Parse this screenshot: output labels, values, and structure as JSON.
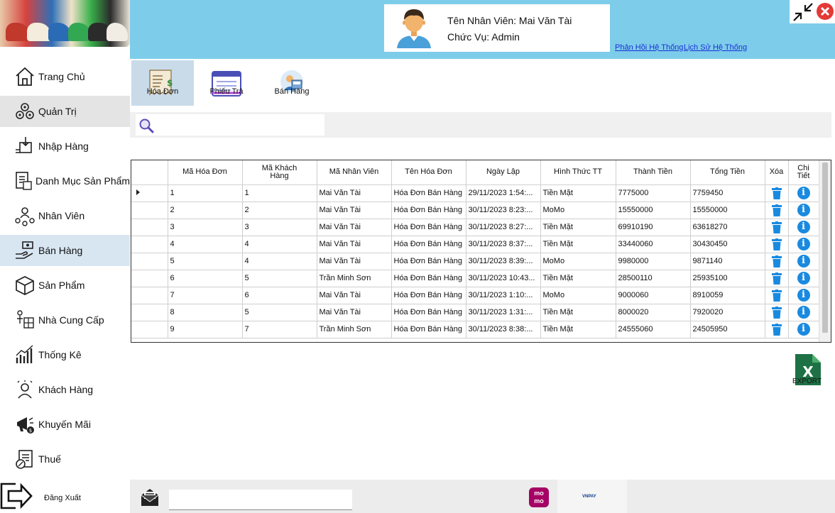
{
  "header": {
    "employee_label": "Tên Nhân Viên: Mai Văn Tài",
    "role_label": "Chức Vụ: Admin",
    "link_feedback": "Phản Hồi Hệ Thống",
    "link_history": "Lịch Sử Hệ Thống"
  },
  "sidebar": {
    "items": [
      {
        "label": "Trang Chủ",
        "icon": "home-icon"
      },
      {
        "label": "Quản Trị",
        "icon": "admin-gears-icon"
      },
      {
        "label": "Nhập Hàng",
        "icon": "import-box-icon"
      },
      {
        "label": "Danh Mục Sản Phẩm",
        "icon": "catalog-icon"
      },
      {
        "label": "Nhân Viên",
        "icon": "employees-icon"
      },
      {
        "label": "Bán Hàng",
        "icon": "sales-icon"
      },
      {
        "label": "Sản Phẩm",
        "icon": "product-box-icon"
      },
      {
        "label": "Nhà Cung Cấp",
        "icon": "supplier-icon"
      },
      {
        "label": "Thống Kê",
        "icon": "statistics-icon"
      },
      {
        "label": "Khách Hàng",
        "icon": "customer-icon"
      },
      {
        "label": "Khuyến Mãi",
        "icon": "promotion-icon"
      },
      {
        "label": "Thuế",
        "icon": "tax-icon"
      }
    ],
    "logout_label": "Đăng Xuất"
  },
  "toolbar": {
    "invoice_label": "Hóa Đơn",
    "return_label": "Phiếu Trả",
    "sales_label": "Bán Hàng"
  },
  "search": {
    "value": ""
  },
  "table": {
    "columns": [
      "Mã Hóa Đơn",
      "Mã Khách Hàng",
      "Mã Nhân Viên",
      "Tên Hóa Đơn",
      "Ngày Lập",
      "Hình Thức TT",
      "Thành Tiền",
      "Tổng Tiền",
      "Xóa",
      "Chi Tiết"
    ],
    "rows": [
      [
        "1",
        "1",
        "Mai Văn Tài",
        "Hóa Đơn Bán Hàng",
        "29/11/2023 1:54:...",
        "Tiền Mặt",
        "7775000",
        "7759450"
      ],
      [
        "2",
        "2",
        "Mai Văn Tài",
        "Hóa Đơn Bán Hàng",
        "30/11/2023 8:23:...",
        "MoMo",
        "15550000",
        "15550000"
      ],
      [
        "3",
        "3",
        "Mai Văn Tài",
        "Hóa Đơn Bán Hàng",
        "30/11/2023 8:27:...",
        "Tiền Mặt",
        "69910190",
        "63618270"
      ],
      [
        "4",
        "4",
        "Mai Văn Tài",
        "Hóa Đơn Bán Hàng",
        "30/11/2023 8:37:...",
        "Tiền Mặt",
        "33440060",
        "30430450"
      ],
      [
        "5",
        "4",
        "Mai Văn Tài",
        "Hóa Đơn Bán Hàng",
        "30/11/2023 8:39:...",
        "MoMo",
        "9980000",
        "9871140"
      ],
      [
        "6",
        "5",
        "Trần Minh Sơn",
        "Hóa Đơn Bán Hàng",
        "30/11/2023 10:43...",
        "Tiền Mặt",
        "28500110",
        "25935100"
      ],
      [
        "7",
        "6",
        "Mai Văn Tài",
        "Hóa Đơn Bán Hàng",
        "30/11/2023 1:10:...",
        "MoMo",
        "9000060",
        "8910059"
      ],
      [
        "8",
        "5",
        "Mai Văn Tài",
        "Hóa Đơn Bán Hàng",
        "30/11/2023 1:31:...",
        "Tiền Mặt",
        "8000020",
        "7920020"
      ],
      [
        "9",
        "7",
        "Trần Minh Sơn",
        "Hóa Đơn Bán Hàng",
        "30/11/2023 8:38:...",
        "Tiền Mặt",
        "24555060",
        "24505950"
      ]
    ]
  },
  "export": {
    "label": "EXPORT"
  },
  "footer": {
    "momo_label": "mo mo",
    "vnpay_label": "VNPAY"
  },
  "colors": {
    "header_bg": "#7dcdea",
    "accent_blue": "#1a8ae0",
    "close_red": "#e53935",
    "excel_green": "#1e7145"
  }
}
